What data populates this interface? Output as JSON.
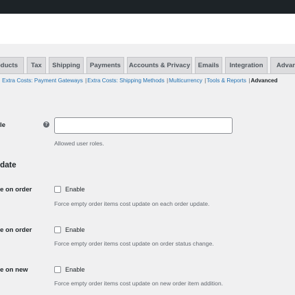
{
  "tabs": [
    {
      "label": "oducts"
    },
    {
      "label": "Tax"
    },
    {
      "label": "Shipping"
    },
    {
      "label": "Payments"
    },
    {
      "label": "Accounts & Privacy"
    },
    {
      "label": "Emails"
    },
    {
      "label": "Integration"
    },
    {
      "label": "Advanc"
    }
  ],
  "subnav": {
    "items": [
      "Extra Costs: Payment Gateways",
      "Extra Costs: Shipping Methods",
      "Multicurrency",
      "Tools & Reports"
    ],
    "current": "Advanced",
    "separator": "|"
  },
  "user_roles": {
    "label": "le",
    "help": "?",
    "value": "",
    "description": "Allowed user roles."
  },
  "section": {
    "title": "date"
  },
  "options": [
    {
      "label": "e on order",
      "checkbox_label": "Enable",
      "checked": false,
      "description": "Force empty order items cost update on each order update."
    },
    {
      "label": "e on order",
      "checkbox_label": "Enable",
      "checked": false,
      "description": "Force empty order items cost update on order status change."
    },
    {
      "label": "e on new",
      "checkbox_label": "Enable",
      "checked": false,
      "description": "Force empty order items cost update on new order item addition."
    }
  ],
  "colors": {
    "link": "#2271b1",
    "background": "#f0f0f1",
    "admin_bar": "#1d2327"
  }
}
